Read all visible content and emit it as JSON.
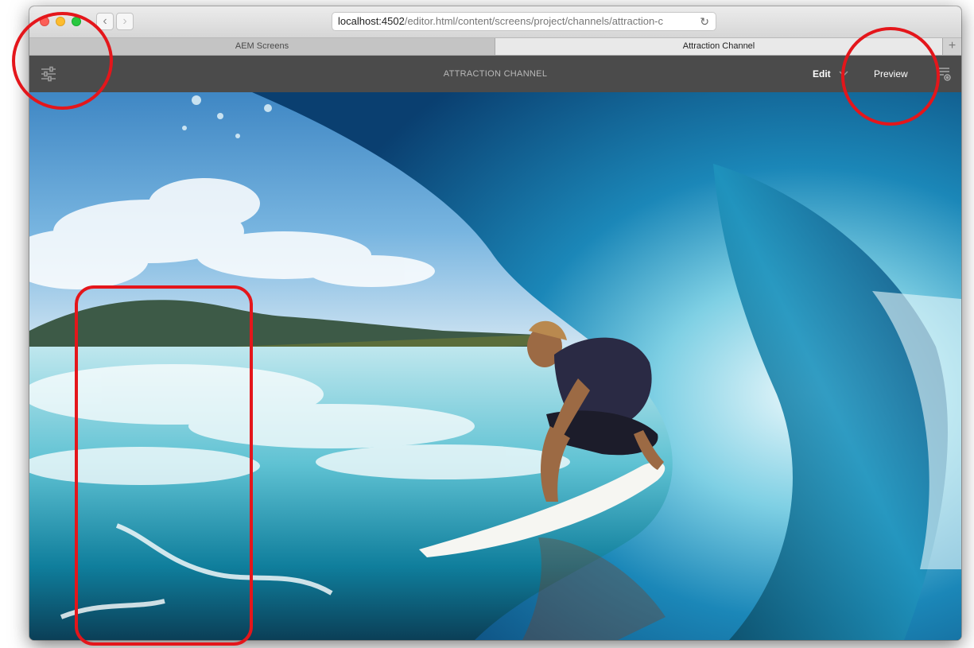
{
  "browser": {
    "nav_back": "‹",
    "nav_forward": "›",
    "url_host": "localhost:4502",
    "url_path": "/editor.html/content/screens/project/channels/attraction-c",
    "reload_icon": "↻",
    "traffic_colors": {
      "close": "#fc5f57",
      "minimize": "#fdbc2e",
      "maximize": "#28c840"
    }
  },
  "tabs": [
    {
      "label": "AEM Screens",
      "active": false
    },
    {
      "label": "Attraction Channel",
      "active": true
    }
  ],
  "new_tab_label": "+",
  "app_toolbar": {
    "side_panel_icon": "sliders-icon",
    "title": "ATTRACTION CHANNEL",
    "edit_label": "Edit",
    "preview_label": "Preview",
    "page_properties_icon": "page-settings-icon"
  },
  "content": {
    "image_subject": "surfer-in-wave-barrel"
  },
  "annotations": {
    "color": "#e4161b",
    "highlights": [
      "side-panel-toggle",
      "preview-button",
      "content-area"
    ]
  }
}
